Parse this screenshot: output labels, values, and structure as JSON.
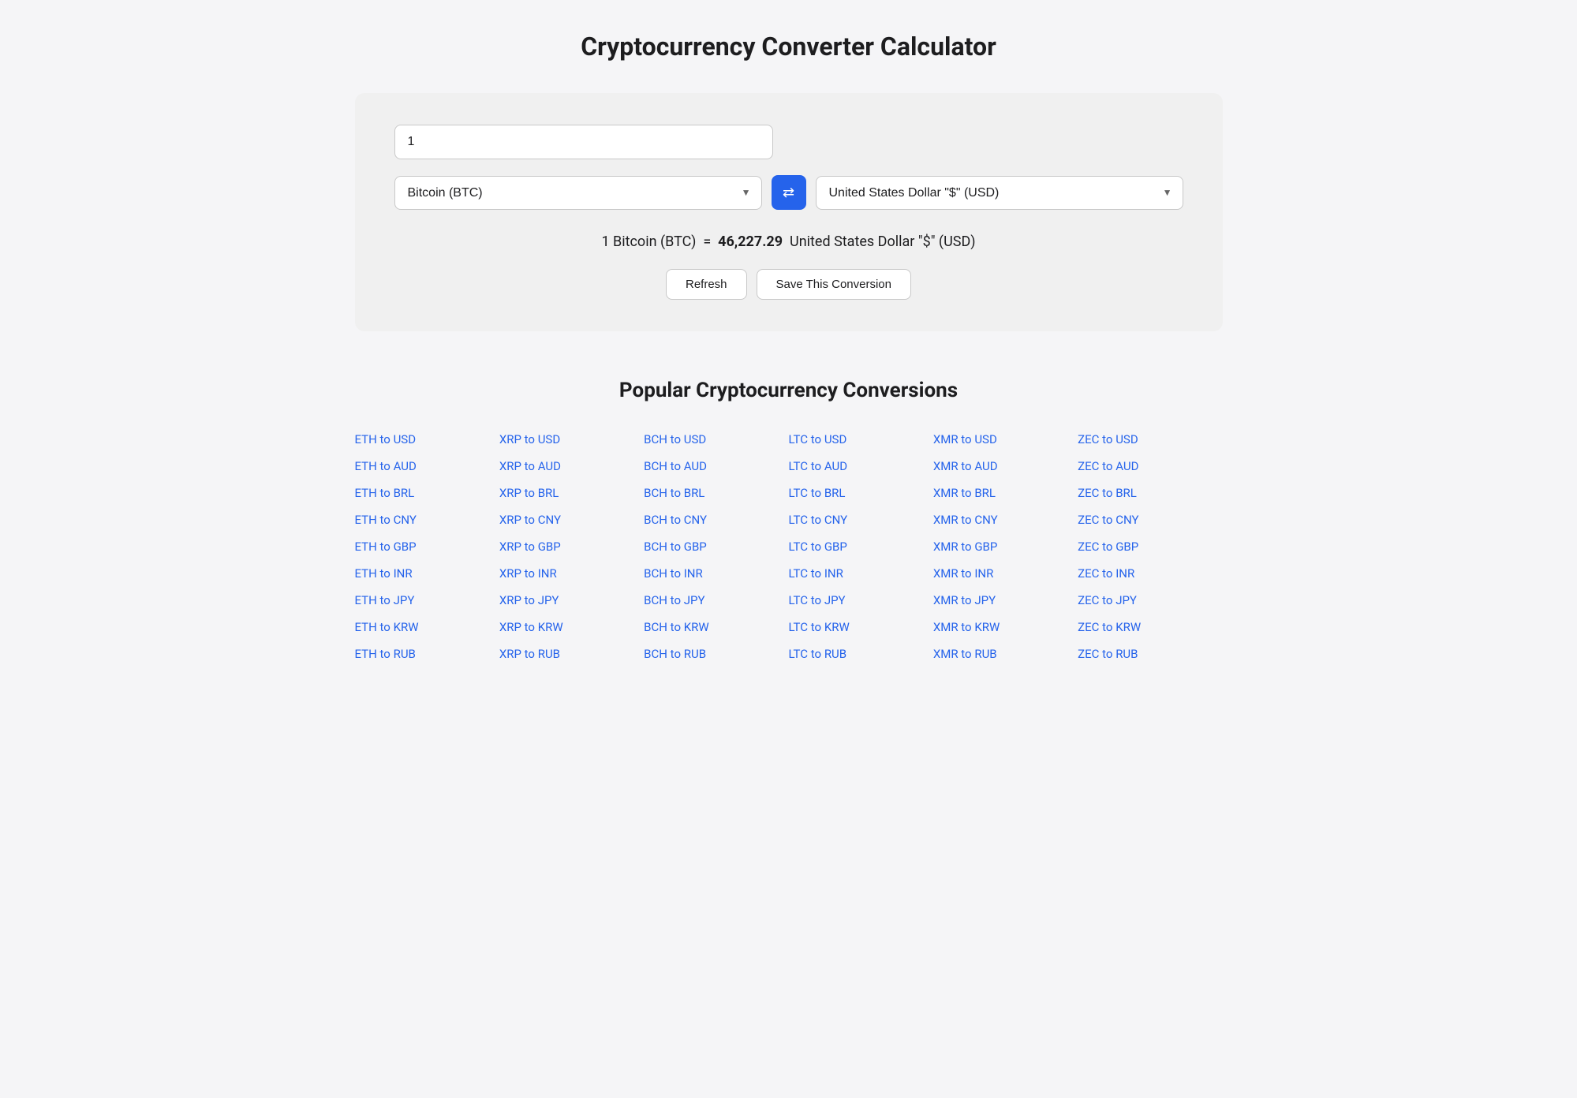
{
  "page": {
    "title": "Cryptocurrency Converter Calculator"
  },
  "converter": {
    "amount_value": "1",
    "amount_placeholder": "",
    "from_currency": "Bitcoin (BTC)",
    "to_currency": "United States Dollar \"$\" (USD)",
    "swap_icon": "⇄",
    "result_text_prefix": "1 Bitcoin (BTC)",
    "result_equals": "=",
    "result_amount": "46,227.29",
    "result_text_suffix": "United States Dollar \"$\" (USD)",
    "refresh_label": "Refresh",
    "save_label": "Save This Conversion"
  },
  "popular": {
    "title": "Popular Cryptocurrency Conversions",
    "columns": [
      {
        "items": [
          "ETH to USD",
          "ETH to AUD",
          "ETH to BRL",
          "ETH to CNY",
          "ETH to GBP",
          "ETH to INR",
          "ETH to JPY",
          "ETH to KRW",
          "ETH to RUB"
        ]
      },
      {
        "items": [
          "XRP to USD",
          "XRP to AUD",
          "XRP to BRL",
          "XRP to CNY",
          "XRP to GBP",
          "XRP to INR",
          "XRP to JPY",
          "XRP to KRW",
          "XRP to RUB"
        ]
      },
      {
        "items": [
          "BCH to USD",
          "BCH to AUD",
          "BCH to BRL",
          "BCH to CNY",
          "BCH to GBP",
          "BCH to INR",
          "BCH to JPY",
          "BCH to KRW",
          "BCH to RUB"
        ]
      },
      {
        "items": [
          "LTC to USD",
          "LTC to AUD",
          "LTC to BRL",
          "LTC to CNY",
          "LTC to GBP",
          "LTC to INR",
          "LTC to JPY",
          "LTC to KRW",
          "LTC to RUB"
        ]
      },
      {
        "items": [
          "XMR to USD",
          "XMR to AUD",
          "XMR to BRL",
          "XMR to CNY",
          "XMR to GBP",
          "XMR to INR",
          "XMR to JPY",
          "XMR to KRW",
          "XMR to RUB"
        ]
      },
      {
        "items": [
          "ZEC to USD",
          "ZEC to AUD",
          "ZEC to BRL",
          "ZEC to CNY",
          "ZEC to GBP",
          "ZEC to INR",
          "ZEC to JPY",
          "ZEC to KRW",
          "ZEC to RUB"
        ]
      }
    ]
  }
}
